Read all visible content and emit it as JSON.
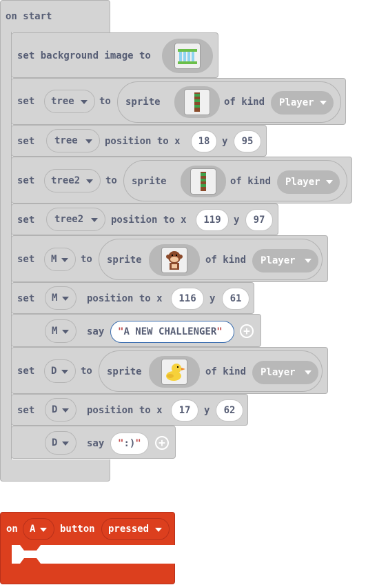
{
  "on_start": {
    "label": "on start"
  },
  "bg": {
    "set": "set",
    "text": "set background image to",
    "image_icon": "waterfall-image-icon"
  },
  "b1": {
    "set": "set",
    "var": "tree",
    "to": "to",
    "sprite": "sprite",
    "of_kind": "of kind",
    "kind": "Player",
    "image_icon": "tree-column-icon"
  },
  "b2": {
    "set": "set",
    "var": "tree",
    "pos": "position to x",
    "y": "y",
    "x_val": "18",
    "y_val": "95"
  },
  "b3": {
    "set": "set",
    "var": "tree2",
    "to": "to",
    "sprite": "sprite",
    "of_kind": "of kind",
    "kind": "Player",
    "image_icon": "tree-column-icon"
  },
  "b4": {
    "set": "set",
    "var": "tree2",
    "pos": "position to x",
    "y": "y",
    "x_val": "119",
    "y_val": "97"
  },
  "b5": {
    "set": "set",
    "var": "M",
    "to": "to",
    "sprite": "sprite",
    "of_kind": "of kind",
    "kind": "Player",
    "image_icon": "monkey-icon"
  },
  "b6": {
    "set": "set",
    "var": "M",
    "pos": "position to x",
    "y": "y",
    "x_val": "116",
    "y_val": "61"
  },
  "b7": {
    "var": "M",
    "say": "say",
    "text": "A NEW CHALLENGER",
    "open_q": "\"",
    "close_q": "\""
  },
  "b8": {
    "set": "set",
    "var": "D",
    "to": "to",
    "sprite": "sprite",
    "of_kind": "of kind",
    "kind": "Player",
    "image_icon": "duck-icon"
  },
  "b9": {
    "set": "set",
    "var": "D",
    "pos": "position to x",
    "y": "y",
    "x_val": "17",
    "y_val": "62"
  },
  "b10": {
    "var": "D",
    "say": "say",
    "text": ":)",
    "open_q": "\"",
    "close_q": "\""
  },
  "on_button": {
    "on": "on",
    "button_var": "A",
    "button": "button",
    "event": "pressed"
  },
  "colors": {
    "gray_block": "#d4d4d4",
    "event_red": "#dc3f1e",
    "text_gray": "#575e75"
  }
}
